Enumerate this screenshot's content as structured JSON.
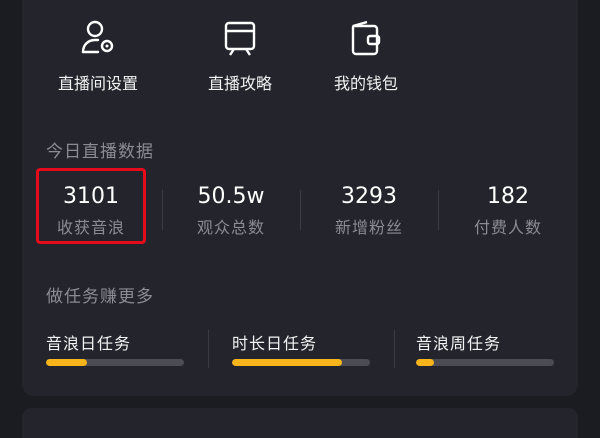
{
  "tools": [
    {
      "label": "直播间设置",
      "icon": "user-gear-icon"
    },
    {
      "label": "直播攻略",
      "icon": "guide-icon"
    },
    {
      "label": "我的钱包",
      "icon": "wallet-icon"
    }
  ],
  "today_section": {
    "title": "今日直播数据"
  },
  "stats": [
    {
      "value": "3101",
      "label": "收获音浪"
    },
    {
      "value": "50.5w",
      "label": "观众总数"
    },
    {
      "value": "3293",
      "label": "新增粉丝"
    },
    {
      "value": "182",
      "label": "付费人数"
    }
  ],
  "tasks_section": {
    "title": "做任务赚更多"
  },
  "tasks": [
    {
      "label": "音浪日任务",
      "progress": 0.3
    },
    {
      "label": "时长日任务",
      "progress": 0.8
    },
    {
      "label": "音浪周任务",
      "progress": 0.13
    }
  ],
  "colors": {
    "background": "#1b1c22",
    "card": "#24252c",
    "accent": "#f7b51b",
    "highlight": "#e60b1a",
    "muted_text": "#8a8b93"
  }
}
